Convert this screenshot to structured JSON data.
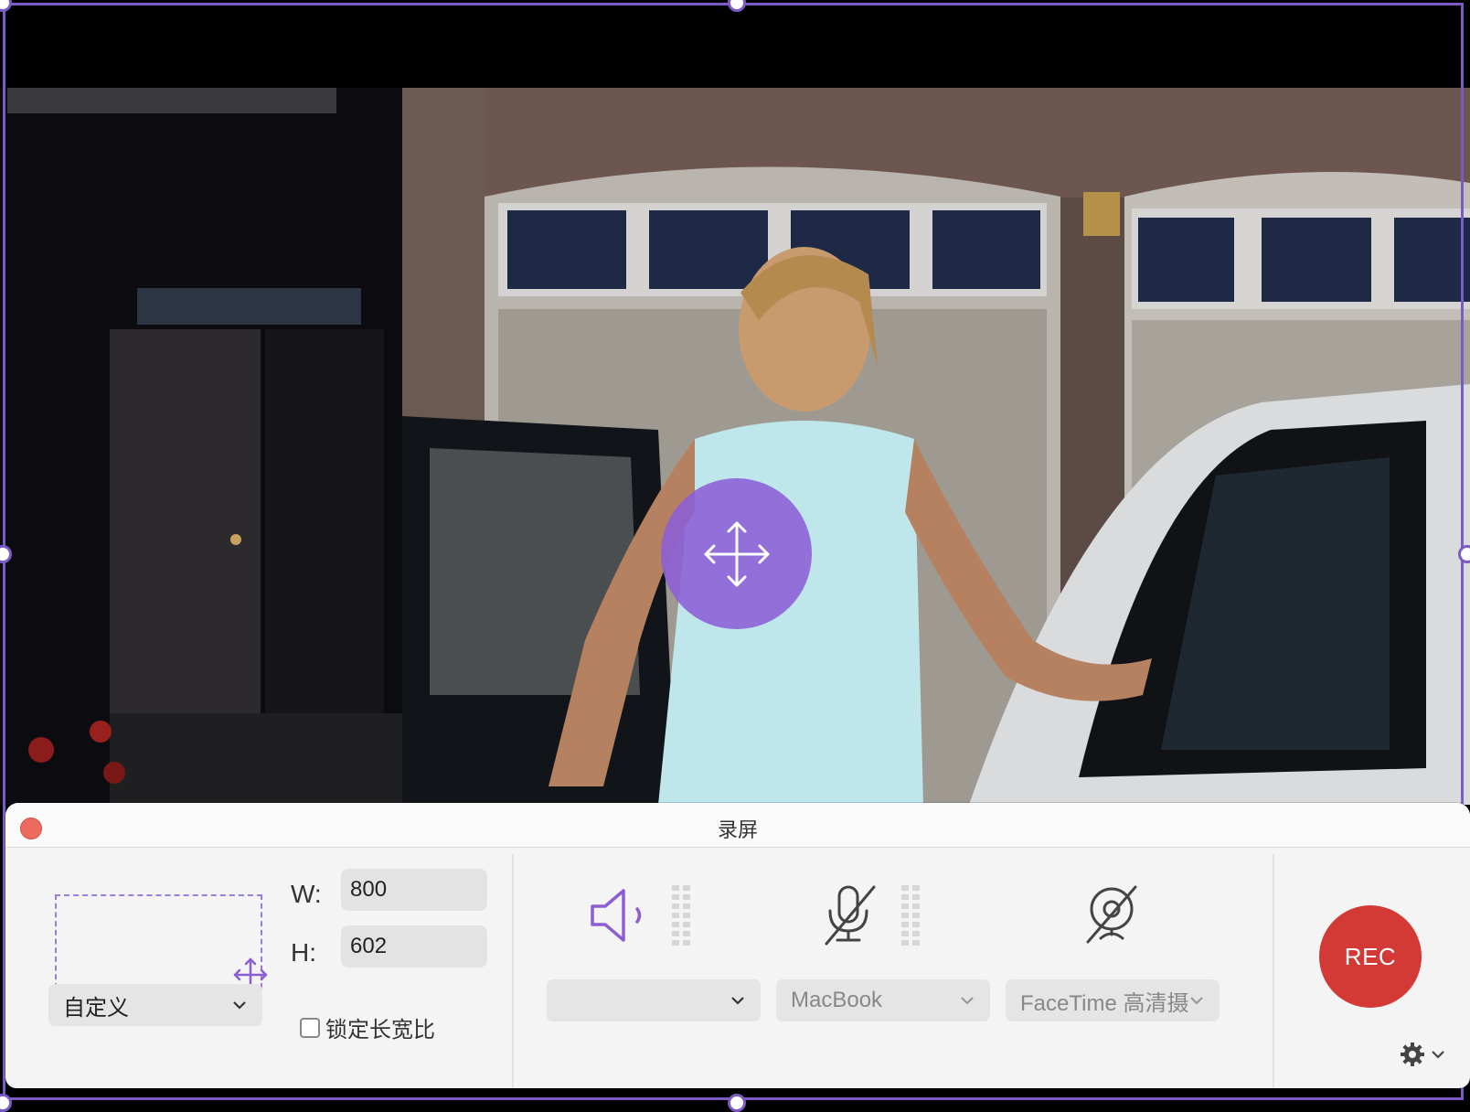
{
  "window": {
    "title": "录屏"
  },
  "capture": {
    "width_label": "W:",
    "width_value": "800",
    "height_label": "H:",
    "height_value": "602",
    "preset": "自定义",
    "lock_ratio_label": "锁定长宽比",
    "lock_ratio_checked": false
  },
  "audio": {
    "speaker_device": "",
    "mic_device": "MacBook",
    "camera_device": "FaceTime 高清摄"
  },
  "controls": {
    "rec_label": "REC"
  },
  "icons": {
    "speaker": "speaker-icon",
    "mic": "microphone-muted-icon",
    "camera": "camera-off-icon",
    "move": "move-arrows-icon",
    "settings": "gear-icon"
  },
  "colors": {
    "accent": "#8c5ed6",
    "frame": "#7d5bc4",
    "rec": "#d33a36",
    "close": "#ed6a5e"
  }
}
